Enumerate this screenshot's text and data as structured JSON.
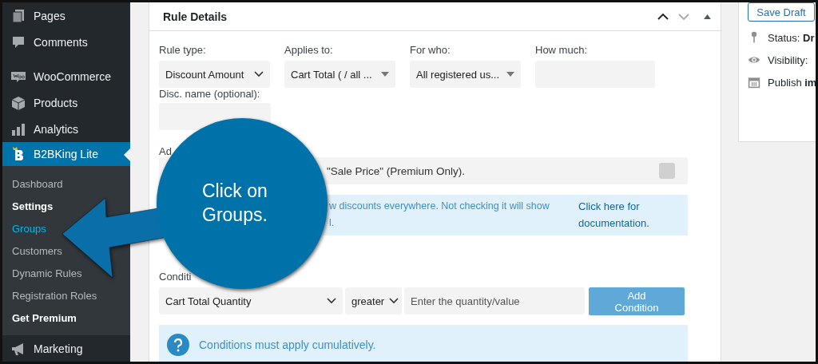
{
  "sidebar": {
    "items": [
      {
        "label": "Pages",
        "selected": false
      },
      {
        "label": "Comments",
        "selected": false
      },
      {
        "label": "WooCommerce",
        "selected": false
      },
      {
        "label": "Products",
        "selected": false
      },
      {
        "label": "Analytics",
        "selected": false
      },
      {
        "label": "B2BKing Lite",
        "selected": true
      }
    ],
    "submenu": [
      {
        "label": "Dashboard",
        "selected": false,
        "emphasized": false
      },
      {
        "label": "Settings",
        "selected": false,
        "emphasized": true
      },
      {
        "label": "Groups",
        "selected": true,
        "emphasized": false
      },
      {
        "label": "Customers",
        "selected": false,
        "emphasized": false
      },
      {
        "label": "Dynamic Rules",
        "selected": false,
        "emphasized": false
      },
      {
        "label": "Registration Roles",
        "selected": false,
        "emphasized": false
      },
      {
        "label": "Get Premium",
        "selected": false,
        "emphasized": true
      }
    ],
    "after": [
      {
        "label": "Marketing",
        "selected": false
      }
    ]
  },
  "panel": {
    "title": "Rule Details",
    "fields": [
      {
        "label": "Rule type:",
        "kind": "select",
        "value": "Discount Amount"
      },
      {
        "label": "Applies to:",
        "kind": "select",
        "value": "Cart Total ( / all ..."
      },
      {
        "label": "For who:",
        "kind": "select",
        "value": "All registered us..."
      },
      {
        "label": "How much:",
        "kind": "input"
      }
    ],
    "name_field": {
      "label": "Disc. name (optional):"
    },
    "additional": {
      "label": "Ad",
      "text": "\"Sale Price\" (Premium Only).",
      "checked": false
    },
    "info": {
      "lines": [
        "w discounts everywhere. Not checking it will show",
        "l."
      ],
      "link": "Click here for documentation."
    },
    "conditions": {
      "label": "Conditi",
      "field": "Cart Total Quantity",
      "operator": "greater",
      "placeholder": "Enter the quantity/value",
      "button": "Add Condition",
      "note": "Conditions must apply cumulatively."
    }
  },
  "publish": {
    "button": "Save Draft",
    "rows": [
      {
        "text": "Status: **Dr**"
      },
      {
        "text": "Visibility:"
      },
      {
        "text": "Publish **im**"
      }
    ]
  },
  "callout": {
    "text": "Click on Groups."
  }
}
